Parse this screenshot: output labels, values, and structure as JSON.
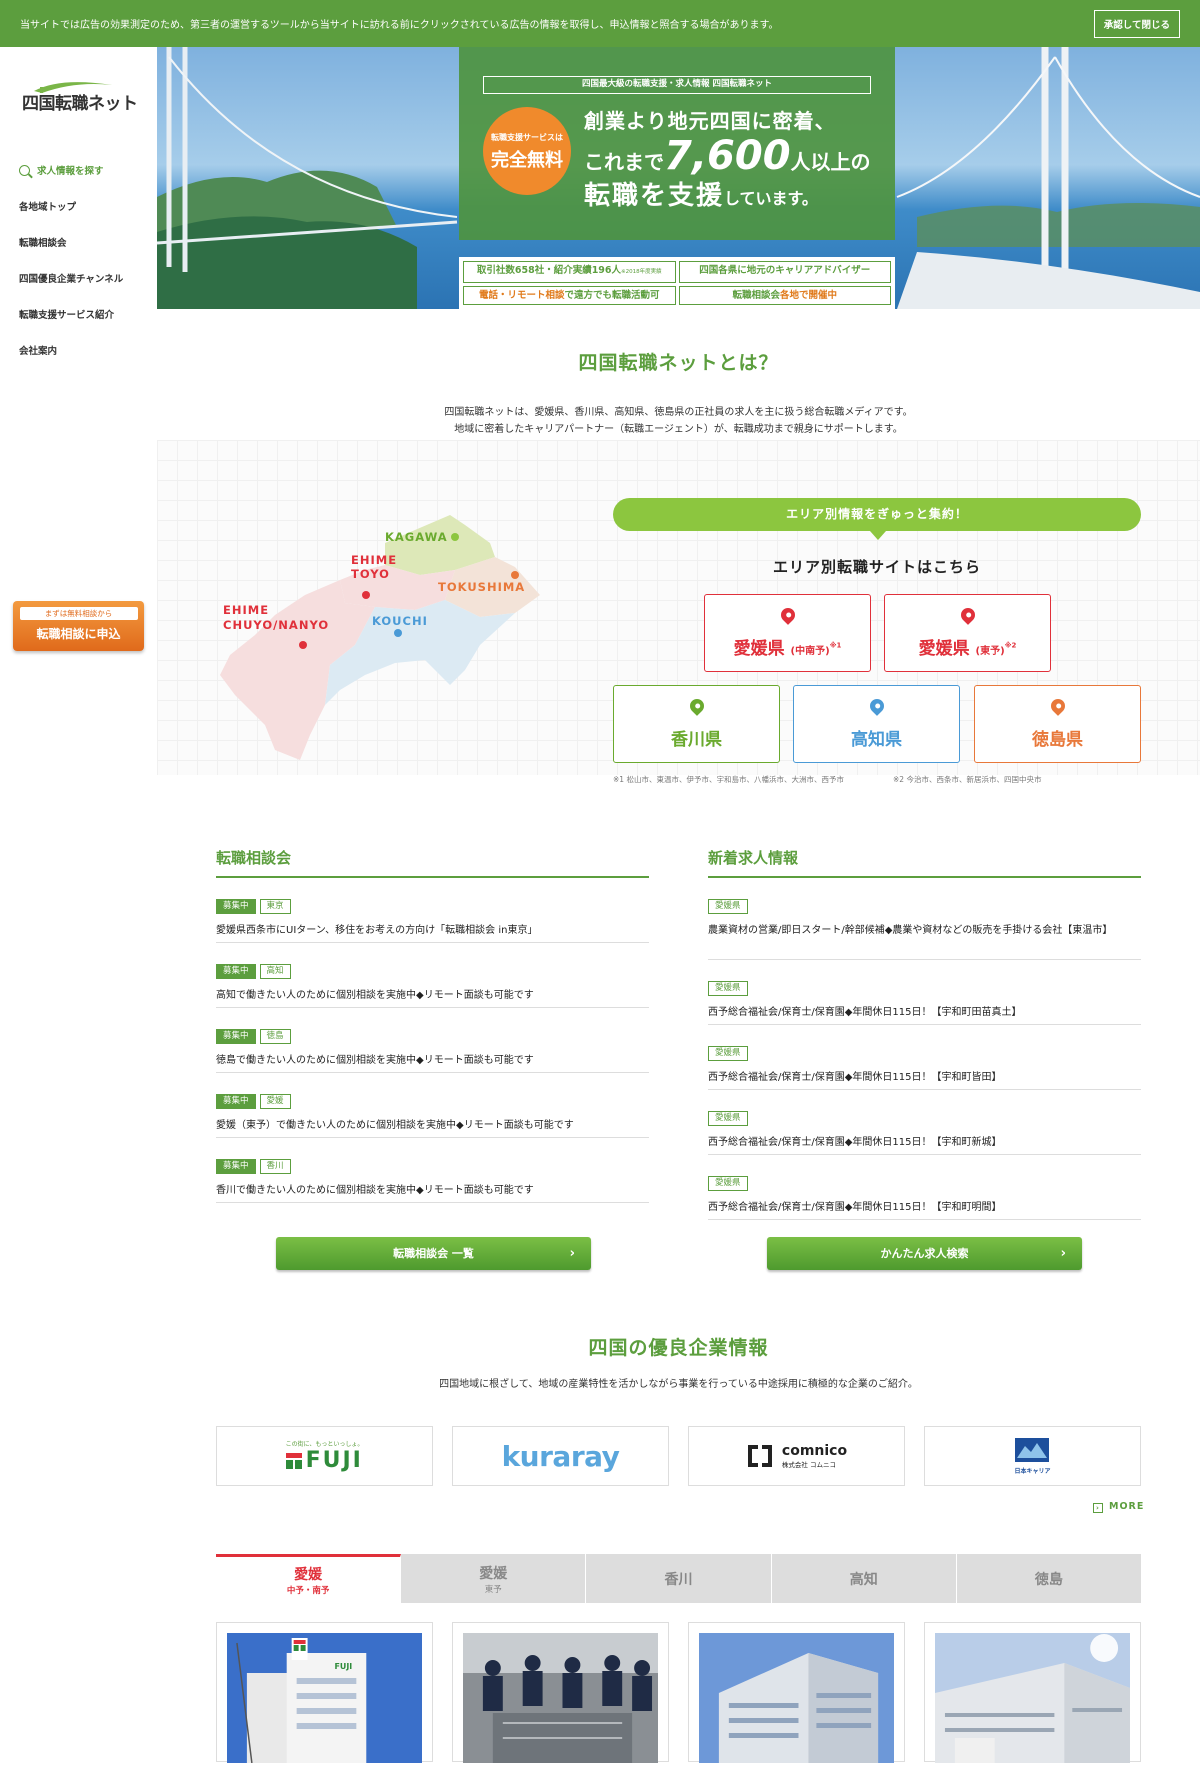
{
  "cookie_bar": {
    "text": "当サイトでは広告の効果測定のため、第三者の運営するツールから当サイトに訪れる前にクリックされている広告の情報を取得し、申込情報と照合する場合があります。",
    "button": "承認して閉じる"
  },
  "brand": {
    "logo": "四国転職ネット"
  },
  "sidebar": {
    "items": [
      {
        "label": "求人情報を探す"
      },
      {
        "label": "各地域トップ"
      },
      {
        "label": "転職相談会"
      },
      {
        "label": "四国優良企業チャンネル"
      },
      {
        "label": "転職支援サービス紹介"
      },
      {
        "label": "会社案内"
      }
    ],
    "cta_small": "まずは無料相談から",
    "cta_big": "転職相談に申込"
  },
  "hero": {
    "top_label": "四国最大級の転職支援・求人情報 四国転職ネット",
    "badge_small": "転職支援サービスは",
    "badge_big": "完全無料",
    "line1": "創業より地元四国に密着、",
    "line2_pre": "これまで",
    "line2_num": "7,600",
    "line2_post": "人以上の",
    "line3_main": "転職を支援",
    "line3_tail": "しています。",
    "boxes": [
      {
        "a": "取引社数658社・紹介実績196人",
        "b": "※2018年度実績"
      },
      {
        "a": "四国各県に地元のキャリアアドバイザー",
        "b": ""
      },
      {
        "a": "電話・リモート相談",
        "b": "で遠方でも転職活動可"
      },
      {
        "a": "転職相談会",
        "b": "各地で開催中"
      }
    ]
  },
  "about": {
    "title": "四国転職ネットとは？",
    "line1": "四国転職ネットは、愛媛県、香川県、高知県、徳島県の正社員の求人を主に扱う総合転職メディアです。",
    "line2": "地域に密着したキャリアパートナー（転職エージェント）が、転職成功まで親身にサポートします。"
  },
  "map": {
    "labels": {
      "kagawa": "KAGAWA",
      "ehime_toyo_1": "EHIME",
      "ehime_toyo_2": "TOYO",
      "tokushima": "TOKUSHIMA",
      "ehime_nanyo_1": "EHIME",
      "ehime_nanyo_2": "CHUYO/NANYO",
      "kochi": "KOUCHI"
    },
    "colors": {
      "kagawa": "#dde8b8",
      "ehime": "#f6dede",
      "tokushima": "#f3e3d8",
      "kochi": "#dceaf3"
    }
  },
  "area": {
    "pill": "エリア別情報をぎゅっと集約！",
    "subtitle": "エリア別転職サイトはこちら",
    "prefs": [
      {
        "name": "愛媛県",
        "sub": "(中南予)",
        "mark": "※1",
        "color": "#e0303a"
      },
      {
        "name": "愛媛県",
        "sub": "(東予)",
        "mark": "※2",
        "color": "#e0303a"
      },
      {
        "name": "香川県",
        "sub": "",
        "mark": "",
        "color": "#6aaa2e"
      },
      {
        "name": "高知県",
        "sub": "",
        "mark": "",
        "color": "#4a9ad6"
      },
      {
        "name": "徳島県",
        "sub": "",
        "mark": "",
        "color": "#e8783a"
      }
    ],
    "note1": "※1 松山市、東温市、伊予市、宇和島市、八幡浜市、大洲市、西予市",
    "note2": "※2 今治市、西条市、新居浜市、四国中央市"
  },
  "events": {
    "title": "転職相談会",
    "items": [
      {
        "status": "募集中",
        "area": "東京",
        "text": "愛媛県西条市にUIターン、移住をお考えの方向け「転職相談会 in東京」"
      },
      {
        "status": "募集中",
        "area": "高知",
        "text": "高知で働きたい人のために個別相談を実施中◆リモート面談も可能です"
      },
      {
        "status": "募集中",
        "area": "徳島",
        "text": "徳島で働きたい人のために個別相談を実施中◆リモート面談も可能です"
      },
      {
        "status": "募集中",
        "area": "愛媛",
        "text": "愛媛（東予）で働きたい人のために個別相談を実施中◆リモート面談も可能です"
      },
      {
        "status": "募集中",
        "area": "香川",
        "text": "香川で働きたい人のために個別相談を実施中◆リモート面談も可能です"
      }
    ],
    "button": "転職相談会 一覧"
  },
  "jobs": {
    "title": "新着求人情報",
    "items": [
      {
        "area": "愛媛県",
        "text": "農業資材の営業/即日スタート/幹部候補◆農業や資材などの販売を手掛ける会社【東温市】"
      },
      {
        "area": "愛媛県",
        "text": "西予総合福祉会/保育士/保育園◆年間休日115日！【宇和町田苗真土】"
      },
      {
        "area": "愛媛県",
        "text": "西予総合福祉会/保育士/保育園◆年間休日115日！【宇和町皆田】"
      },
      {
        "area": "愛媛県",
        "text": "西予総合福祉会/保育士/保育園◆年間休日115日！【宇和町新城】"
      },
      {
        "area": "愛媛県",
        "text": "西予総合福祉会/保育士/保育園◆年間休日115日！【宇和町明間】"
      }
    ],
    "button": "かんたん求人検索"
  },
  "companies": {
    "title": "四国の優良企業情報",
    "text": "四国地域に根ざして、地域の産業特性を活かしながら事業を行っている中途採用に積極的な企業のご紹介。",
    "logos": [
      {
        "name": "FUJI",
        "tagline": "この街に、もっといっしょ。"
      },
      {
        "name": "kuraray"
      },
      {
        "name": "comnico",
        "sub": "株式会社 コムニコ"
      },
      {
        "name": "日本キャリア"
      }
    ],
    "more": "MORE",
    "tabs": [
      {
        "label": "愛媛",
        "sub": "中予・南予",
        "active": true
      },
      {
        "label": "愛媛",
        "sub": "東予",
        "active": false
      },
      {
        "label": "香川",
        "sub": "",
        "active": false
      },
      {
        "label": "高知",
        "sub": "",
        "active": false
      },
      {
        "label": "徳島",
        "sub": "",
        "active": false
      }
    ],
    "photo_sign": "FUJI"
  }
}
